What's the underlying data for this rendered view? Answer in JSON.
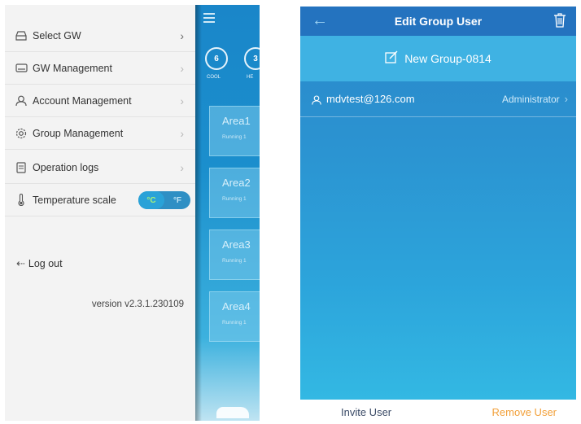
{
  "left_screen": {
    "menu": [
      {
        "label": "Select GW",
        "icon": "gateway-icon"
      },
      {
        "label": "GW Management",
        "icon": "gw-device-icon"
      },
      {
        "label": "Account Management",
        "icon": "user-icon"
      },
      {
        "label": "Group Management",
        "icon": "gear-icon"
      },
      {
        "label": "Operation logs",
        "icon": "document-icon"
      },
      {
        "label": "Temperature scale",
        "icon": "thermometer-icon"
      }
    ],
    "temperature_options": [
      "°C",
      "°F"
    ],
    "temperature_selected": "°C",
    "logout_label": "Log out",
    "version": "version v2.3.1.230109",
    "background_app": {
      "modes": [
        {
          "value": "6",
          "label": "COOL"
        },
        {
          "value": "3",
          "label": "HE"
        }
      ],
      "areas": [
        {
          "name": "Area1",
          "status": "Running 1"
        },
        {
          "name": "Area2",
          "status": "Running 1"
        },
        {
          "name": "Area3",
          "status": "Running 1"
        },
        {
          "name": "Area4",
          "status": "Running 1"
        }
      ]
    }
  },
  "right_screen": {
    "title": "Edit Group User",
    "group_name": "New Group-0814",
    "users": [
      {
        "email": "mdvtest@126.com",
        "role": "Administrator"
      }
    ],
    "invite_label": "Invite User",
    "remove_label": "Remove User",
    "colors": {
      "header": "#2473bf",
      "accent_remove": "#f2a03a"
    }
  }
}
